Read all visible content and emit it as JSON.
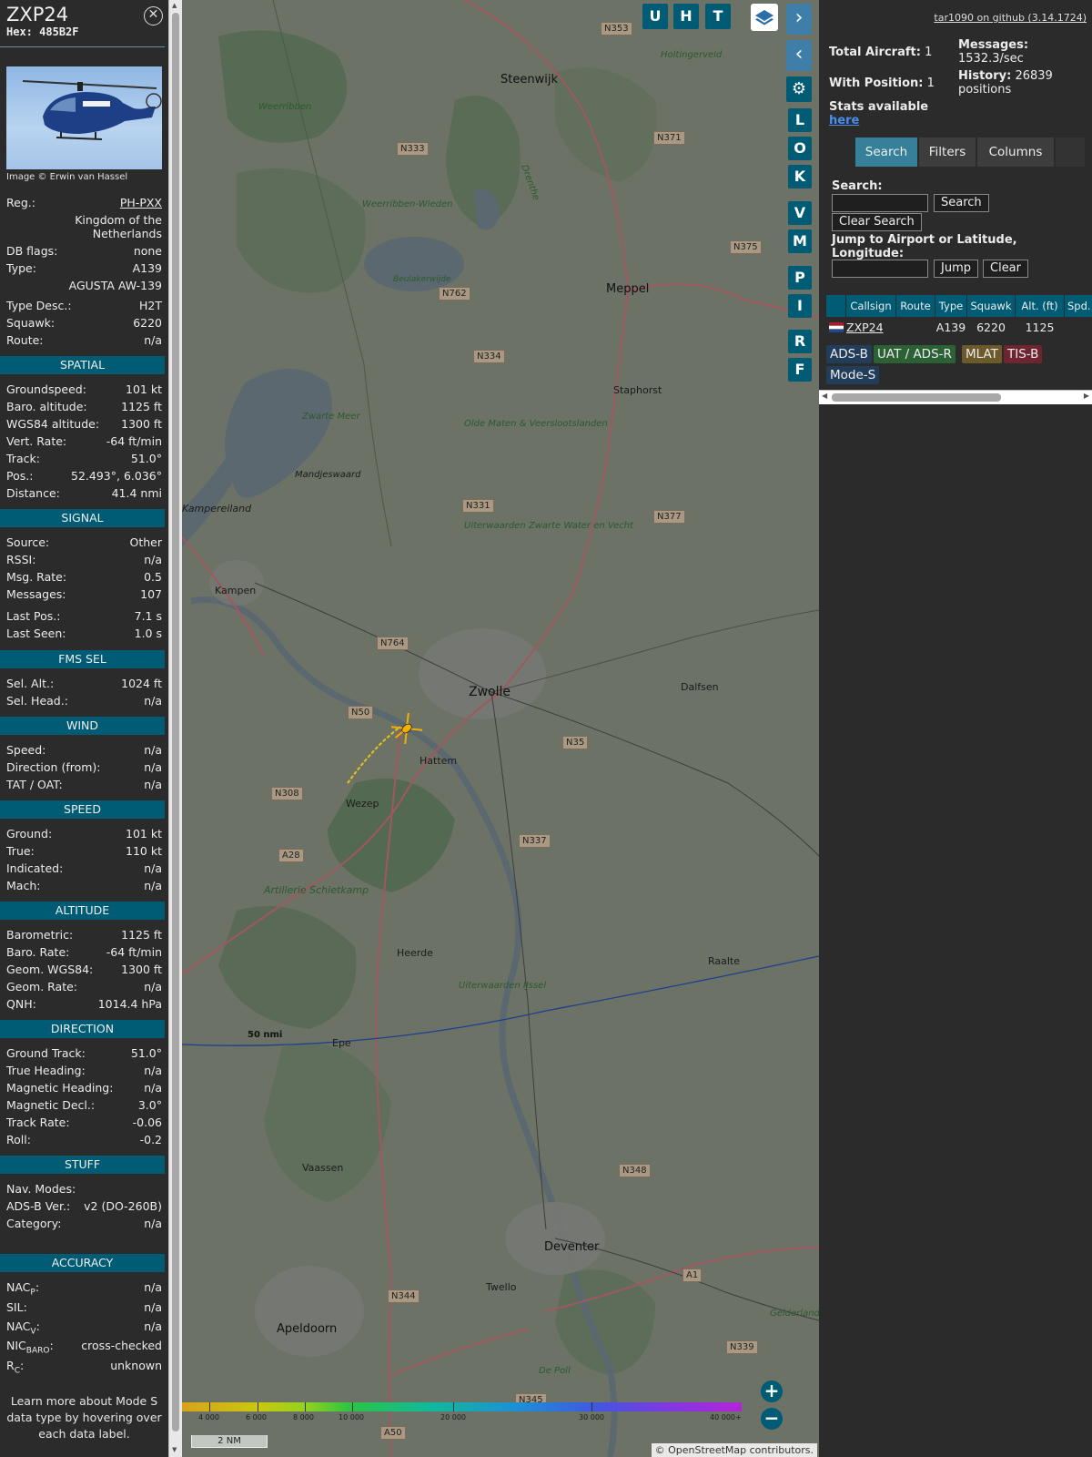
{
  "aircraft": {
    "callsign": "ZXP24",
    "hex_label": "Hex:",
    "hex": "485B2F",
    "image_credit": "Image © Erwin van Hassel"
  },
  "info_rows": {
    "reg": {
      "label": "Reg.:",
      "value": "PH-PXX"
    },
    "country": "Kingdom of the Netherlands",
    "db_flags": {
      "label": "DB flags:",
      "value": "none"
    },
    "type": {
      "label": "Type:",
      "value": "A139"
    },
    "type_name": "AGUSTA AW-139",
    "type_desc": {
      "label": "Type Desc.:",
      "value": "H2T"
    },
    "squawk": {
      "label": "Squawk:",
      "value": "6220"
    },
    "route": {
      "label": "Route:",
      "value": "n/a"
    }
  },
  "sections": {
    "spatial": {
      "title": "SPATIAL",
      "rows": [
        {
          "label": "Groundspeed:",
          "value": "101 kt"
        },
        {
          "label": "Baro. altitude:",
          "value": "1125 ft"
        },
        {
          "label": "WGS84 altitude:",
          "value": "1300 ft"
        },
        {
          "label": "Vert. Rate:",
          "value": "-64 ft/min"
        },
        {
          "label": "Track:",
          "value": "51.0°"
        },
        {
          "label": "Pos.:",
          "value": "52.493°, 6.036°"
        },
        {
          "label": "Distance:",
          "value": "41.4 nmi"
        }
      ]
    },
    "signal": {
      "title": "SIGNAL",
      "rows": [
        {
          "label": "Source:",
          "value": "Other"
        },
        {
          "label": "RSSI:",
          "value": "n/a"
        },
        {
          "label": "Msg. Rate:",
          "value": "0.5"
        },
        {
          "label": "Messages:",
          "value": "107"
        },
        {
          "label": "Last Pos.:",
          "value": "7.1 s"
        },
        {
          "label": "Last Seen:",
          "value": "1.0 s"
        }
      ]
    },
    "fms": {
      "title": "FMS SEL",
      "rows": [
        {
          "label": "Sel. Alt.:",
          "value": "1024 ft"
        },
        {
          "label": "Sel. Head.:",
          "value": "n/a"
        }
      ]
    },
    "wind": {
      "title": "WIND",
      "rows": [
        {
          "label": "Speed:",
          "value": "n/a"
        },
        {
          "label": "Direction (from):",
          "value": "n/a"
        },
        {
          "label": "TAT / OAT:",
          "value": "n/a"
        }
      ]
    },
    "speed": {
      "title": "SPEED",
      "rows": [
        {
          "label": "Ground:",
          "value": "101 kt"
        },
        {
          "label": "True:",
          "value": "110 kt"
        },
        {
          "label": "Indicated:",
          "value": "n/a"
        },
        {
          "label": "Mach:",
          "value": "n/a"
        }
      ]
    },
    "altitude": {
      "title": "ALTITUDE",
      "rows": [
        {
          "label": "Barometric:",
          "value": "1125 ft"
        },
        {
          "label": "Baro. Rate:",
          "value": "-64 ft/min"
        },
        {
          "label": "Geom. WGS84:",
          "value": "1300 ft"
        },
        {
          "label": "Geom. Rate:",
          "value": "n/a"
        },
        {
          "label": "QNH:",
          "value": "1014.4 hPa"
        }
      ]
    },
    "direction": {
      "title": "DIRECTION",
      "rows": [
        {
          "label": "Ground Track:",
          "value": "51.0°"
        },
        {
          "label": "True Heading:",
          "value": "n/a"
        },
        {
          "label": "Magnetic Heading:",
          "value": "n/a"
        },
        {
          "label": "Magnetic Decl.:",
          "value": "3.0°"
        },
        {
          "label": "Track Rate:",
          "value": "-0.06"
        },
        {
          "label": "Roll:",
          "value": "-0.2"
        }
      ]
    },
    "stuff": {
      "title": "STUFF",
      "rows": [
        {
          "label": "Nav. Modes:",
          "value": ""
        },
        {
          "label": "ADS-B Ver.:",
          "value": "v2 (DO-260B)"
        },
        {
          "label": "Category:",
          "value": "n/a"
        }
      ]
    },
    "accuracy": {
      "title": "ACCURACY",
      "rows": [
        {
          "label": "NAC",
          "sub": "P",
          "value": "n/a"
        },
        {
          "label": "SIL:",
          "sub": "",
          "value": "n/a"
        },
        {
          "label": "NAC",
          "sub": "V",
          "value": "n/a"
        },
        {
          "label": "NIC",
          "sub": "BARO",
          "value": "cross-checked"
        },
        {
          "label": "R",
          "sub": "C",
          "value": "unknown"
        }
      ]
    }
  },
  "footnote": "Learn more about Mode S data type by hovering over each data label.",
  "map": {
    "buttons": [
      "U",
      "H",
      "T"
    ],
    "side_buttons": [
      "L",
      "O",
      "K",
      "V",
      "M",
      "P",
      "I",
      "R",
      "F"
    ],
    "places": [
      "Steenwijk",
      "Meppel",
      "Staphorst",
      "Zwolle",
      "Dalfsen",
      "Hattem",
      "Wezep",
      "Kampen",
      "Kampereiland",
      "Heerde",
      "Raalte",
      "Epe",
      "Vaassen",
      "Deventer",
      "Twello",
      "Apeldoorn",
      "Mandjeswaard"
    ],
    "nature": [
      "Weerribben",
      "Weerribben-Wieden",
      "Beulakerwijde",
      "Zwarte Meer",
      "Olde Maten & Veerslootslanden",
      "Uiterwaarden Zwarte Water en Vecht",
      "Artillerie Schietkamp",
      "Uiterwaarden IJssel",
      "Gelderland",
      "De Poll",
      "Holtingerveld",
      "Drenthe"
    ],
    "roads": [
      "N353",
      "N333",
      "N371",
      "N375",
      "N762",
      "N334",
      "N331",
      "N377",
      "N764",
      "N50",
      "N35",
      "N308",
      "N337",
      "A28",
      "N348",
      "N344",
      "A1",
      "N339",
      "N345",
      "A50"
    ],
    "range_label": "50 nmi",
    "scale_label": "2 NM",
    "alt_labels": [
      "4 000",
      "6 000",
      "8 000",
      "10 000",
      "20 000",
      "30 000",
      "40 000+"
    ],
    "attribution": "© OpenStreetMap contributors."
  },
  "side": {
    "version_link": "tar1090 on github (3.14.1724)",
    "total_aircraft": {
      "label": "Total Aircraft:",
      "value": "1"
    },
    "with_position": {
      "label": "With Position:",
      "value": "1"
    },
    "messages": {
      "label": "Messages:",
      "value": "1532.3/sec"
    },
    "history": {
      "label": "History:",
      "value": "26839 positions"
    },
    "stats_text": "Stats available",
    "stats_link": "here",
    "tabs": [
      "Search",
      "Filters",
      "Columns"
    ],
    "search_label": "Search:",
    "search_button": "Search",
    "clear_search_button": "Clear Search",
    "jump_label": "Jump to Airport or Latitude, Longitude:",
    "jump_button": "Jump",
    "clear_button": "Clear",
    "table": {
      "columns": [
        "Callsign",
        "Route",
        "Type",
        "Squawk",
        "Alt. (ft)",
        "Spd."
      ],
      "rows": [
        {
          "callsign": "ZXP24",
          "route": "",
          "type": "A139",
          "squawk": "6220",
          "alt": "1125",
          "spd": ""
        }
      ]
    },
    "legend": [
      {
        "label": "ADS-B",
        "color": "#213d5a"
      },
      {
        "label": "UAT / ADS-R",
        "color": "#2c6136"
      },
      {
        "label": "MLAT",
        "color": "#6d5a2b"
      },
      {
        "label": "TIS-B",
        "color": "#6e2530"
      },
      {
        "label": "Mode-S",
        "color": "#213d5a"
      }
    ]
  },
  "colors": {
    "accent": "#005c75",
    "map_bg": "#6c7266",
    "panel_bg": "#2b2b2b"
  }
}
